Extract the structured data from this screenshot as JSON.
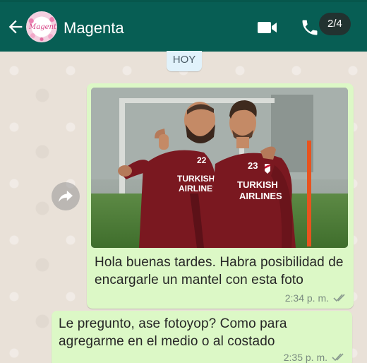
{
  "header": {
    "contact_name": "Magenta",
    "avatar_logo_text": "Magenta",
    "media_counter": "2/4"
  },
  "icons": {
    "back": "arrow-left-icon",
    "video": "video-camera-icon",
    "phone": "phone-icon",
    "forward": "forward-arrow-icon",
    "read_receipt": "double-check-icon"
  },
  "colors": {
    "app_bar": "#075e54",
    "outgoing_bubble": "#dcf8c6",
    "day_chip": "#e1f2fb",
    "wallpaper": "#e9e1d8"
  },
  "chat": {
    "day_label": "HOY",
    "messages": [
      {
        "type": "image",
        "caption": "Hola buenas tardes. Habra posibilidad de encargarle un mantel con esta foto",
        "time": "2:34 p. m.",
        "photo_text": {
          "sponsor_line1": "TURKISH",
          "sponsor_line2": "AIRLINES",
          "shirt_number_left": "22",
          "shirt_number_right": "23"
        }
      },
      {
        "type": "text",
        "text": "Le pregunto, ase fotoyop? Como para agregarme en el medio o al costado",
        "time": "2:35 p. m."
      }
    ]
  }
}
